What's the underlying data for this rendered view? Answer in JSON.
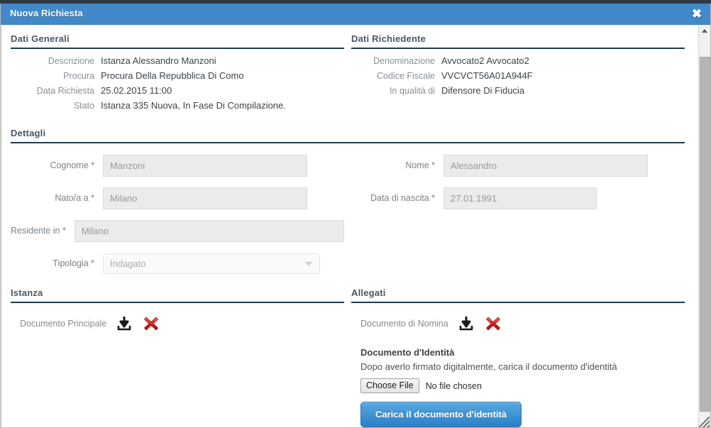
{
  "window": {
    "title": "Nuova Richiesta",
    "close_label": "✖",
    "accent_color": "#4189c8",
    "rule_color": "#1f3a52"
  },
  "sections": {
    "dati_generali": {
      "title": "Dati Generali",
      "rows": [
        {
          "label": "Descrizione",
          "value": "Istanza Alessandro Manzoni"
        },
        {
          "label": "Procura",
          "value": "Procura Della Repubblica Di Como"
        },
        {
          "label": "Data Richiesta",
          "value": "25.02.2015 11:00"
        },
        {
          "label": "Stato",
          "value": "Istanza 335 Nuova, In Fase Di Compilazione."
        }
      ]
    },
    "dati_richiedente": {
      "title": "Dati Richiedente",
      "rows": [
        {
          "label": "Denominazione",
          "value": "Avvocato2 Avvocato2"
        },
        {
          "label": "Codice Fiscale",
          "value": "VVCVCT56A01A944F"
        },
        {
          "label": "In qualità di",
          "value": "Difensore Di Fiducia"
        }
      ]
    },
    "dettagli": {
      "title": "Dettagli",
      "fields": {
        "cognome": {
          "label": "Cognome *",
          "value": "Manzoni"
        },
        "nome": {
          "label": "Nome *",
          "value": "Alessandro"
        },
        "nato_a": {
          "label": "Nato/a a *",
          "value": "Milano"
        },
        "data_nascita": {
          "label": "Data di nascita *",
          "value": "27.01.1991"
        },
        "residente_in": {
          "label": "Residente in *",
          "value": "Milano"
        },
        "tipologia": {
          "label": "Tipologia *",
          "value": "Indagato"
        }
      }
    },
    "istanza": {
      "title": "Istanza",
      "attachment": {
        "label": "Documento Principale"
      }
    },
    "allegati": {
      "title": "Allegati",
      "attachment": {
        "label": "Documento di Nomina"
      },
      "identity": {
        "heading": "Documento d'Identità",
        "instructions": "Dopo averlo firmato digitalmente, carica il documento d'identità",
        "choose_file_label": "Choose File",
        "file_status": "No file chosen",
        "upload_button": "Carica il documento d'identità"
      }
    }
  }
}
